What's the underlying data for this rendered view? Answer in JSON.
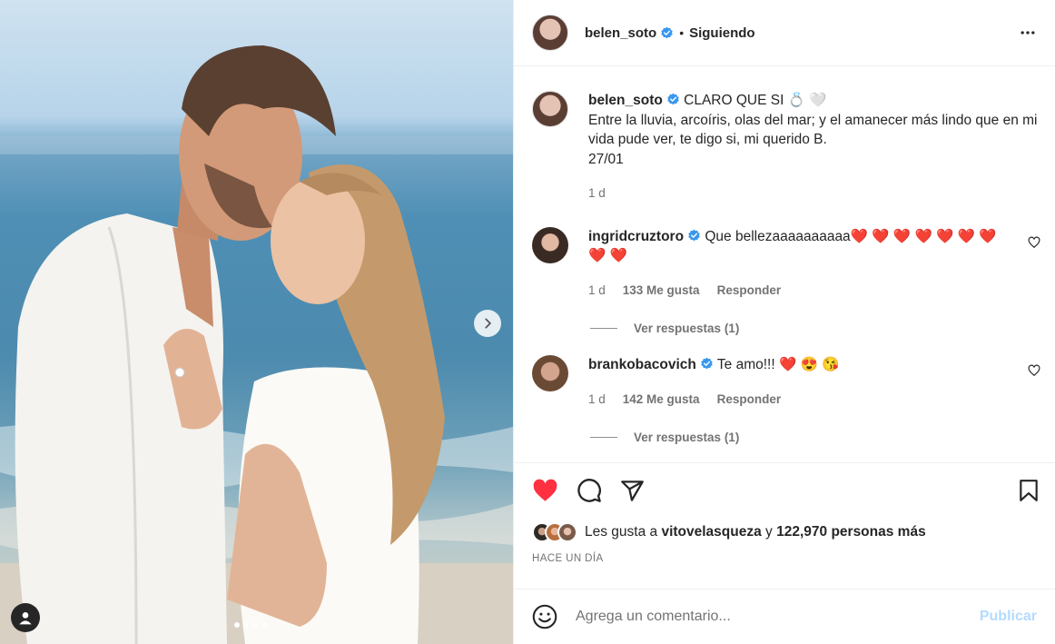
{
  "post": {
    "author": "belen_soto",
    "follow_status": "Siguiendo",
    "separator": "•",
    "caption_title": "CLARO QUE SI 💍 🤍",
    "caption_text": "Entre la lluvia, arcoíris, olas del mar; y el amanecer más lindo que en mi vida pude ver, te digo si, mi querido B.",
    "caption_date": "27/01",
    "caption_age": "1 d",
    "carousel": {
      "slides": 4,
      "current": 1
    }
  },
  "comments": [
    {
      "user": "ingridcruztoro",
      "text": "Que bellezaaaaaaaaaa❤️ ❤️ ❤️ ❤️ ❤️ ❤️ ❤️ ❤️ ❤️",
      "age": "1 d",
      "likes": "133 Me gusta",
      "reply": "Responder",
      "view_replies": "Ver respuestas (1)"
    },
    {
      "user": "brankobacovich",
      "text": "Te amo!!! ❤️ 😍 😘",
      "age": "1 d",
      "likes": "142 Me gusta",
      "reply": "Responder",
      "view_replies": "Ver respuestas (1)"
    }
  ],
  "likes": {
    "prefix": "Les gusta a ",
    "user": "vitovelasqueza",
    "middle": " y ",
    "others": "122,970 personas más"
  },
  "timestamp": "HACE UN DÍA",
  "composer": {
    "placeholder": "Agrega un comentario...",
    "publish": "Publicar"
  },
  "colors": {
    "verified": "#3897f0",
    "like_red": "#ff3040",
    "publish_disabled": "#b3dbff",
    "secondary_text": "#737373"
  },
  "icons": [
    "more-icon",
    "verified-icon",
    "heart-icon",
    "comment-icon",
    "share-icon",
    "save-icon",
    "emoji-icon",
    "chevron-right-icon",
    "user-tag-icon"
  ]
}
